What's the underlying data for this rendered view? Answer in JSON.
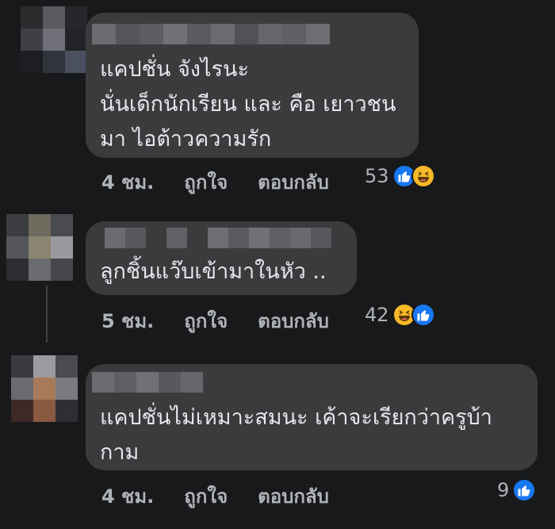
{
  "comments": [
    {
      "text_lines": [
        "แคปชั่น จังไรนะ",
        "นั่นเด็กนักเรียน และ คือ เยาวชน",
        "มา ไอต้าวความรัก"
      ],
      "time": "4 ชม.",
      "like": "ถูกใจ",
      "reply": "ตอบกลับ",
      "reaction_count": "53",
      "reactions": [
        "like-icon",
        "haha-icon"
      ]
    },
    {
      "text_lines": [
        "ลูกชิ้นแว๊บเข้ามาในหัว  .."
      ],
      "time": "5 ชม.",
      "like": "ถูกใจ",
      "reply": "ตอบกลับ",
      "reaction_count": "42",
      "reactions": [
        "haha-icon",
        "like-icon"
      ]
    },
    {
      "text_lines": [
        "แคปชั่นไม่เหมาะสมนะ เค้าจะเรียกว่าครูบ้า",
        "กาม"
      ],
      "time": "4 ชม.",
      "like": "ถูกใจ",
      "reply": "ตอบกลับ",
      "reaction_count": "9",
      "reactions": [
        "like-icon"
      ]
    }
  ],
  "colors": {
    "background": "#18191a",
    "bubble": "#3a3b3c",
    "text": "#e4e6eb",
    "secondary": "#b0b3b8",
    "like": "#1877f2",
    "haha": "#f7b928"
  }
}
